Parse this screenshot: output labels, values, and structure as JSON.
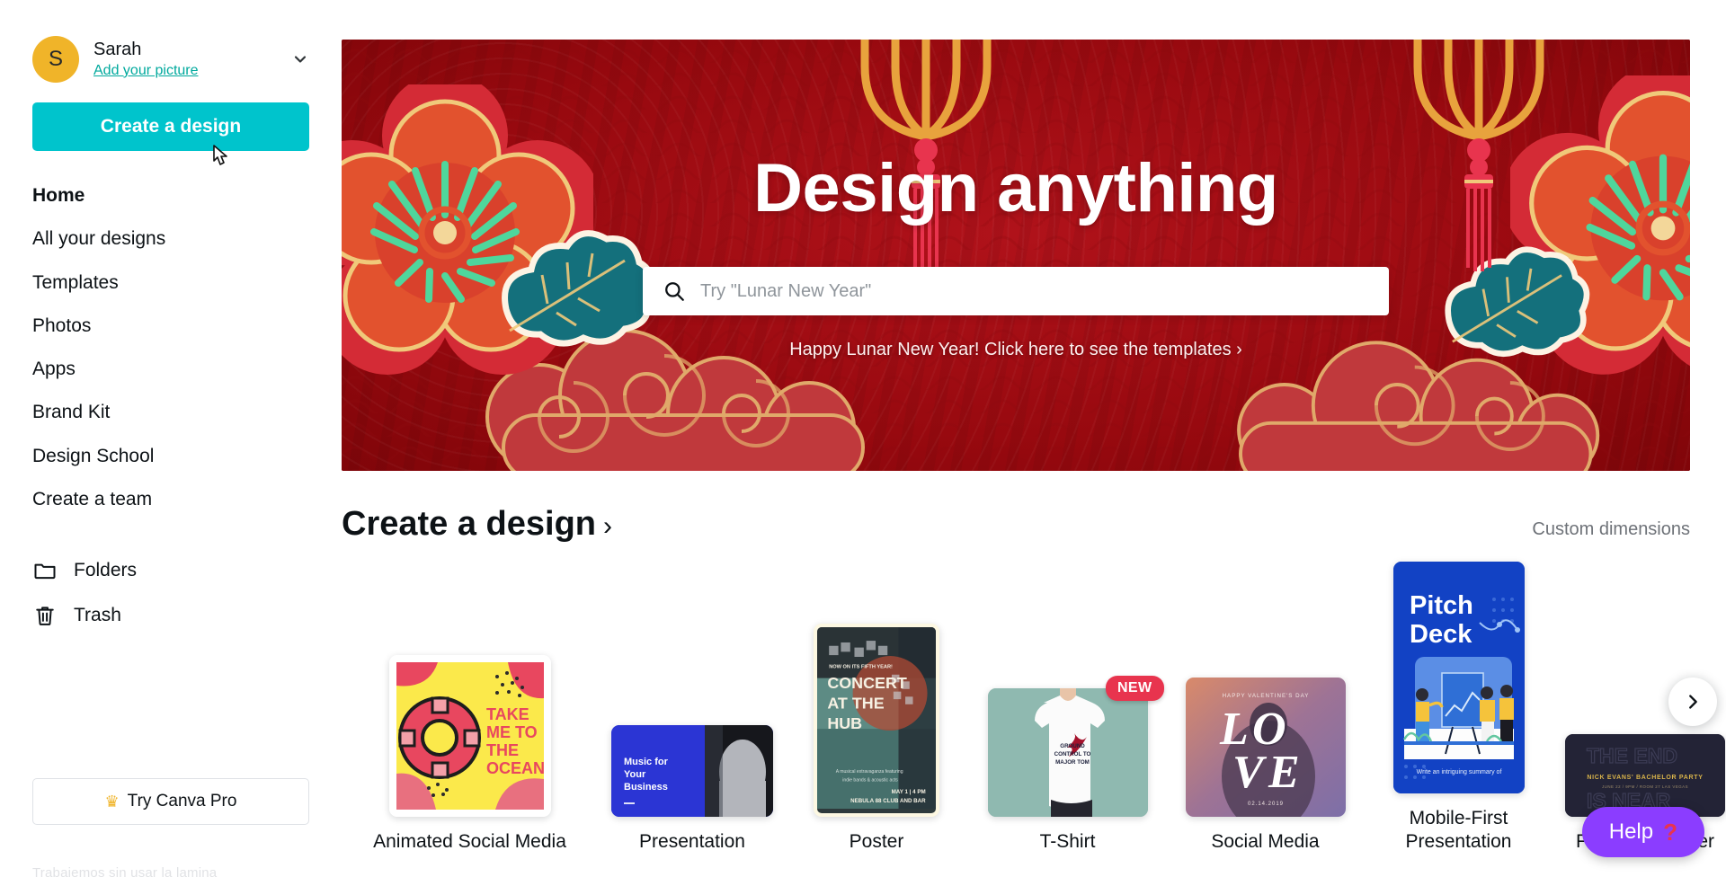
{
  "sidebar": {
    "profile": {
      "initial": "S",
      "name": "Sarah",
      "add_picture_label": "Add your picture"
    },
    "create_design_label": "Create a design",
    "nav_items": [
      {
        "label": "Home",
        "active": true
      },
      {
        "label": "All your designs",
        "active": false
      },
      {
        "label": "Templates",
        "active": false
      },
      {
        "label": "Photos",
        "active": false
      },
      {
        "label": "Apps",
        "active": false
      },
      {
        "label": "Brand Kit",
        "active": false
      },
      {
        "label": "Design School",
        "active": false
      },
      {
        "label": "Create a team",
        "active": false
      }
    ],
    "secondary_items": [
      {
        "label": "Folders",
        "icon": "folder-icon"
      },
      {
        "label": "Trash",
        "icon": "trash-icon"
      }
    ],
    "pro_button": {
      "label": "Try Canva Pro",
      "icon": "crown-icon"
    },
    "footer_ghost_text": "Trabajemos sin usar la lamina"
  },
  "hero": {
    "title": "Design anything",
    "search": {
      "placeholder": "Try \"Lunar New Year\"",
      "value": "",
      "icon": "search-icon"
    },
    "promo_link": "Happy Lunar New Year! Click here to see the templates ›",
    "background_color": "#a50b10"
  },
  "section": {
    "title": "Create a design",
    "title_arrow": "›",
    "custom_dimensions_label": "Custom dimensions"
  },
  "cards": [
    {
      "label": "Animated Social Media",
      "badge": null,
      "art": {
        "lines": [
          "TAKE",
          "ME TO",
          "THE",
          "OCEAN"
        ],
        "bg": "#fbe94b",
        "accent": "#e8475f"
      }
    },
    {
      "label": "Presentation",
      "badge": null,
      "art": {
        "lines": [
          "Music for",
          "Your",
          "Business"
        ],
        "bg": "#2b35d4"
      }
    },
    {
      "label": "Poster",
      "badge": null,
      "art": {
        "kicker": "NOW ON ITS FIFTH YEAR!",
        "lines": [
          "CONCERT",
          "AT THE",
          "HUB"
        ],
        "body": "A musical extravaganza featuring indie bands & acoustic acts",
        "date": "MAY 1 | 4 PM",
        "venue": "NEBULA 88 CLUB AND BAR"
      }
    },
    {
      "label": "T-Shirt",
      "badge": "NEW",
      "art": {
        "lines": [
          "GROUND",
          "CONTROL TO",
          "MAJOR TOM"
        ],
        "bg": "#8fb9b0"
      }
    },
    {
      "label": "Social Media",
      "badge": null,
      "art": {
        "kicker": "HAPPY VALENTINE'S DAY",
        "word": "LOVE",
        "date": "02.14.2019"
      }
    },
    {
      "label": "Mobile-First Presentation",
      "badge": null,
      "art": {
        "lines": [
          "Pitch",
          "Deck"
        ],
        "caption": "Write an intriguing summary of",
        "bg": "#1242c4"
      }
    },
    {
      "label": "Facebook Cover",
      "badge": null,
      "art": {
        "ghost_lines": [
          "THE END",
          "IS NEAR"
        ],
        "title": "NICK EVANS' BACHELOR PARTY",
        "sub": "JUNE 22 / 9PM / ROOM 27 LAS VEGAS"
      }
    }
  ],
  "carousel": {
    "next_icon": "chevron-right-icon"
  },
  "help": {
    "label": "Help",
    "mark": "?"
  }
}
